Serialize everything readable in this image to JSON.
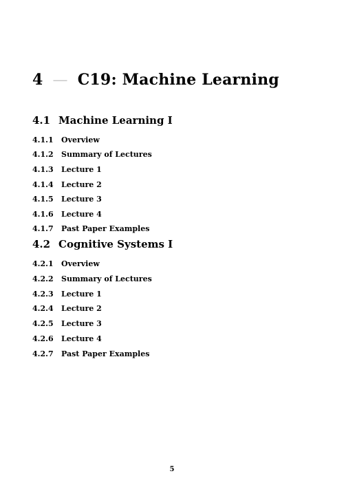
{
  "chapter": {
    "number": "4",
    "separator": "—",
    "title": "C19: Machine Learning"
  },
  "sections": [
    {
      "number": "4.1",
      "title": "Machine Learning I",
      "subsections": [
        {
          "number": "4.1.1",
          "title": "Overview"
        },
        {
          "number": "4.1.2",
          "title": "Summary of Lectures"
        },
        {
          "number": "4.1.3",
          "title": "Lecture 1"
        },
        {
          "number": "4.1.4",
          "title": "Lecture 2"
        },
        {
          "number": "4.1.5",
          "title": "Lecture 3"
        },
        {
          "number": "4.1.6",
          "title": "Lecture 4"
        },
        {
          "number": "4.1.7",
          "title": "Past Paper Examples"
        }
      ]
    },
    {
      "number": "4.2",
      "title": "Cognitive Systems I",
      "subsections": [
        {
          "number": "4.2.1",
          "title": "Overview"
        },
        {
          "number": "4.2.2",
          "title": "Summary of Lectures"
        },
        {
          "number": "4.2.3",
          "title": "Lecture 1"
        },
        {
          "number": "4.2.4",
          "title": "Lecture 2"
        },
        {
          "number": "4.2.5",
          "title": "Lecture 3"
        },
        {
          "number": "4.2.6",
          "title": "Lecture 4"
        },
        {
          "number": "4.2.7",
          "title": "Past Paper Examples"
        }
      ]
    }
  ],
  "page_number": "5"
}
